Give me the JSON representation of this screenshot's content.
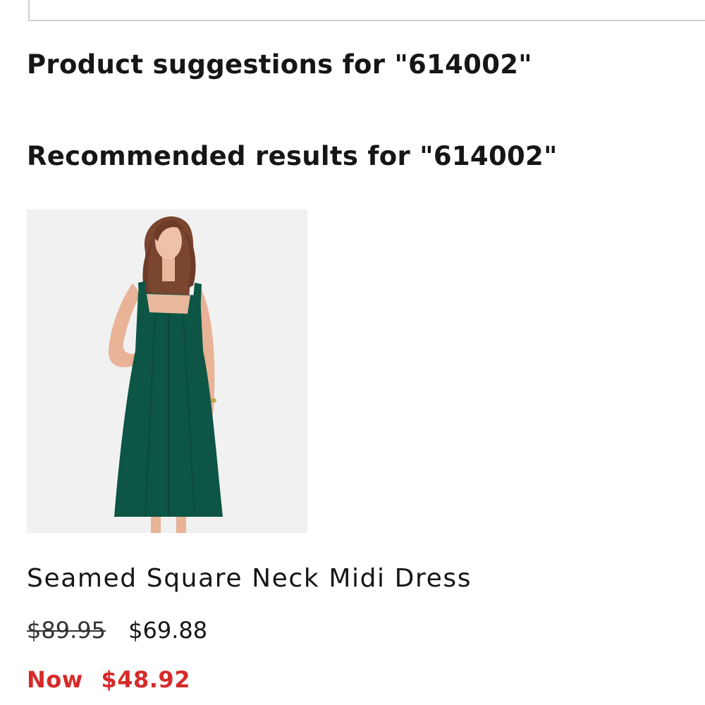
{
  "search": {
    "value": ""
  },
  "headings": {
    "suggestions": "Product suggestions for \"614002\"",
    "recommended": "Recommended results for \"614002\""
  },
  "product": {
    "name": "Seamed Square Neck Midi Dress",
    "original_price": "$89.95",
    "sale_price": "$69.88",
    "now_label": "Now",
    "now_price": "$48.92",
    "image_icon": "dress-photo",
    "dress_color": "#0d5544",
    "now_price_color": "#d62a2a"
  }
}
